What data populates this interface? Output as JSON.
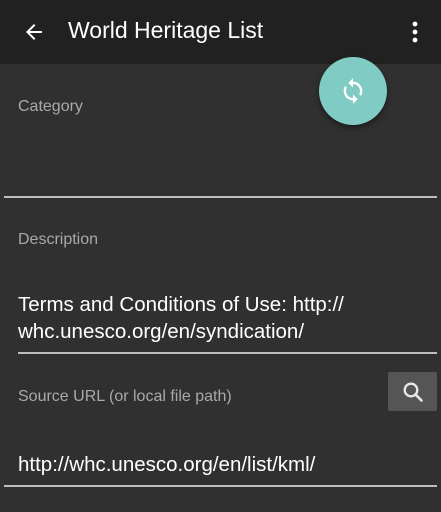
{
  "appbar": {
    "title": "World Heritage List",
    "back_icon": "arrow-left-icon",
    "overflow_icon": "more-vert-icon",
    "background": "#212121"
  },
  "fab": {
    "icon": "refresh-sync-icon",
    "color": "#80cbc4"
  },
  "form": {
    "category": {
      "label": "Category",
      "value": ""
    },
    "description": {
      "label": "Description",
      "value": "Terms and Conditions of Use: http://\nwhc.unesco.org/en/syndication/"
    },
    "source_url": {
      "label": "Source URL (or local file path)",
      "value": "http://whc.unesco.org/en/list/kml/",
      "search_icon": "search-icon"
    }
  },
  "colors": {
    "background": "#303030",
    "label": "#a9a9a9",
    "text": "#ffffff",
    "underline": "#bdbdbd",
    "search_button": "#555555"
  }
}
